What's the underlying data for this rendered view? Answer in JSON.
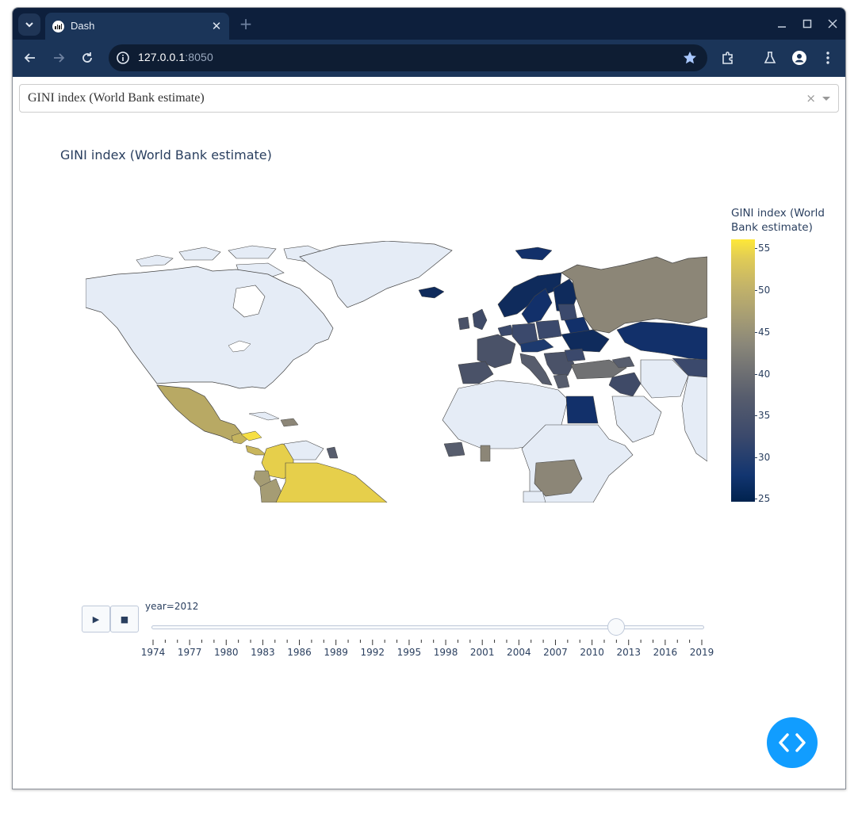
{
  "browser": {
    "tab": {
      "title": "Dash"
    },
    "url": {
      "host": "127.0.0.1",
      "port": ":8050"
    }
  },
  "dropdown": {
    "value": "GINI index (World Bank estimate)",
    "clear_glyph": "×"
  },
  "graph": {
    "title": "GINI index (World Bank estimate)",
    "colorbar": {
      "title_line1": "GINI index (World",
      "title_line2": "Bank estimate)",
      "ticks": [
        55,
        50,
        45,
        40,
        35,
        30,
        25
      ],
      "range": [
        25,
        56
      ],
      "colorscale": "Cividis"
    },
    "slider": {
      "current_label": "year=2012",
      "current_year": 2012,
      "start_year": 1974,
      "end_year": 2019,
      "year_labels": [
        "1974",
        "1977",
        "1980",
        "1983",
        "1986",
        "1989",
        "1992",
        "1995",
        "1998",
        "2001",
        "2004",
        "2007",
        "2010",
        "2013",
        "2016",
        "2019"
      ]
    },
    "controls": {
      "play_glyph": "▶",
      "stop_glyph": "■"
    }
  },
  "icons": {
    "tab_search": "chevron-down-icon",
    "back": "arrow-left-icon",
    "forward": "arrow-right-icon",
    "reload": "reload-icon",
    "site_info": "info-icon",
    "bookmark": "star-icon",
    "extensions": "puzzle-icon",
    "labs": "flask-icon",
    "profile": "profile-icon",
    "menu": "kebab-menu-icon",
    "dev_tools": "code-brackets-icon"
  },
  "colors": {
    "frame": "#0d1f3c",
    "toolbar": "#1b3559",
    "no_data": "#e5ecf6",
    "dash_blue": "#119dff"
  }
}
